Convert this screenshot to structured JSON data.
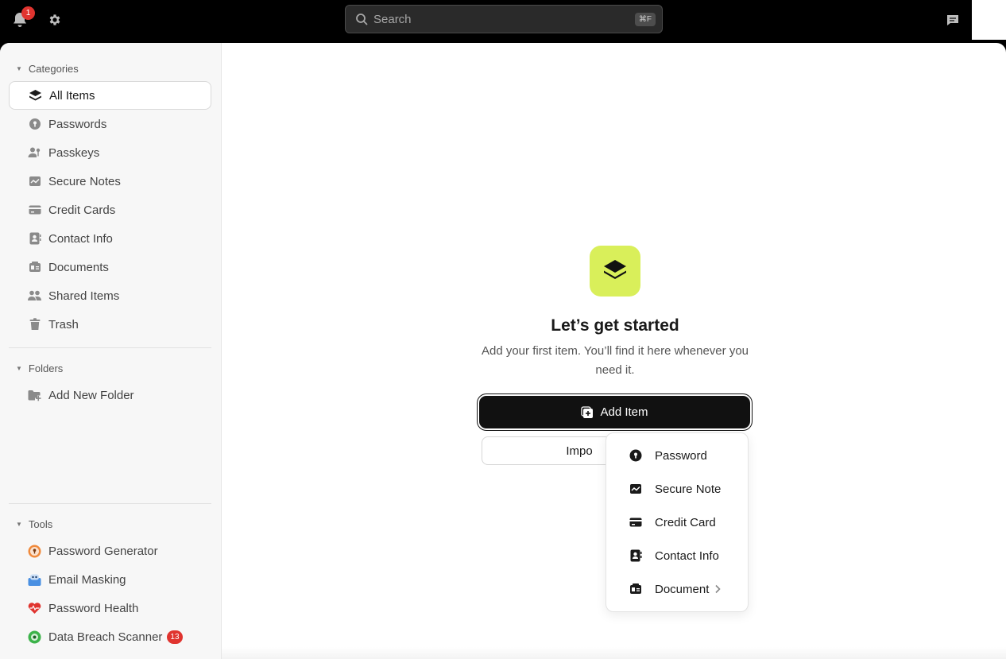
{
  "topbar": {
    "notification_count": "1",
    "search_placeholder": "Search",
    "search_shortcut": "⌘F"
  },
  "sidebar": {
    "categories_label": "Categories",
    "categories": [
      {
        "label": "All Items",
        "icon": "layers-icon",
        "active": true
      },
      {
        "label": "Passwords",
        "icon": "key-icon"
      },
      {
        "label": "Passkeys",
        "icon": "passkey-icon"
      },
      {
        "label": "Secure Notes",
        "icon": "note-icon"
      },
      {
        "label": "Credit Cards",
        "icon": "credit-card-icon"
      },
      {
        "label": "Contact Info",
        "icon": "contact-icon"
      },
      {
        "label": "Documents",
        "icon": "document-icon"
      },
      {
        "label": "Shared Items",
        "icon": "people-icon"
      },
      {
        "label": "Trash",
        "icon": "trash-icon"
      }
    ],
    "folders_label": "Folders",
    "add_folder_label": "Add New Folder",
    "tools_label": "Tools",
    "tools": [
      {
        "label": "Password Generator",
        "icon": "password-generator-icon",
        "color": "#f08a3c"
      },
      {
        "label": "Email Masking",
        "icon": "email-masking-icon",
        "color": "#4a90e2"
      },
      {
        "label": "Password Health",
        "icon": "heart-pulse-icon",
        "color": "#e0342f"
      },
      {
        "label": "Data Breach Scanner",
        "icon": "breach-scanner-icon",
        "color": "#3cb34a",
        "badge": "13"
      }
    ]
  },
  "main": {
    "title": "Let’s get started",
    "subtitle": "Add your first item. You’ll find it here whenever you need it.",
    "add_item_label": "Add Item",
    "import_label": "Impo",
    "accent_color": "#d9ef5a"
  },
  "add_menu": {
    "items": [
      {
        "label": "Password",
        "icon": "key-icon"
      },
      {
        "label": "Secure Note",
        "icon": "note-icon"
      },
      {
        "label": "Credit Card",
        "icon": "credit-card-icon"
      },
      {
        "label": "Contact Info",
        "icon": "contact-icon"
      },
      {
        "label": "Document",
        "icon": "document-icon",
        "submenu": true
      }
    ]
  }
}
